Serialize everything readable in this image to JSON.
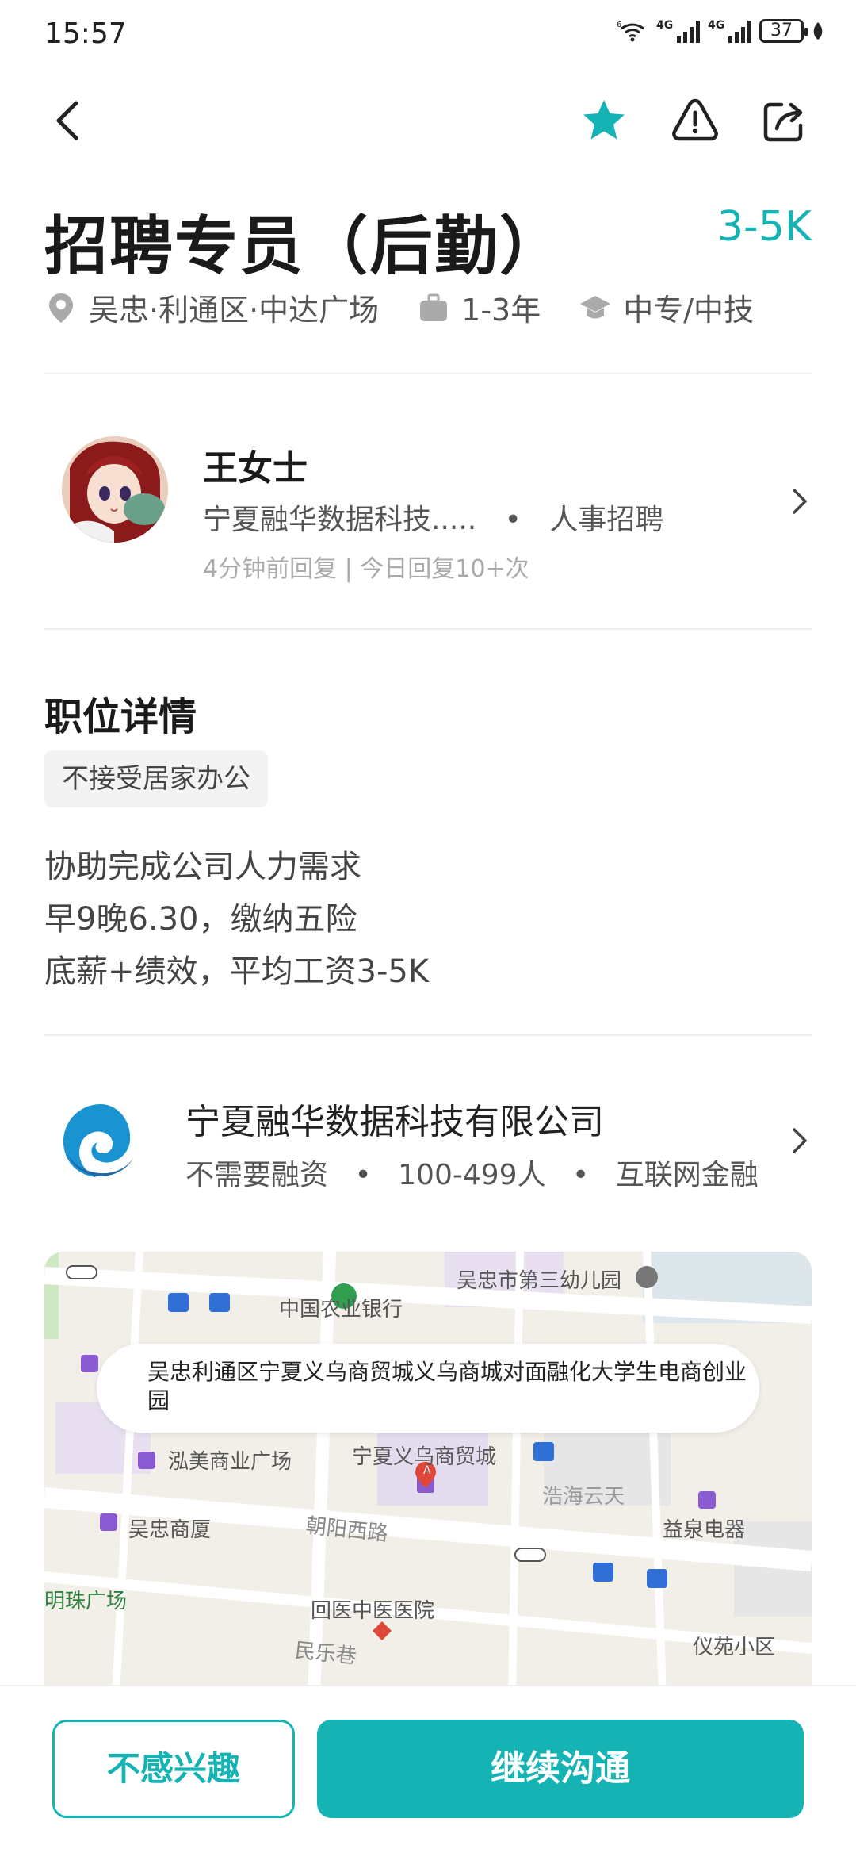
{
  "status_bar": {
    "time": "15:57",
    "battery": "37",
    "signal_label": "4G",
    "wifi_label": "6"
  },
  "nav": {
    "icons": [
      "back-arrow-icon",
      "star-icon",
      "warning-icon",
      "share-icon"
    ],
    "accent_color": "#15b3b3"
  },
  "job": {
    "title": "招聘专员（后勤）",
    "salary": "3-5K",
    "location": "吴忠·利通区·中达广场",
    "experience": "1-3年",
    "education": "中专/中技"
  },
  "recruiter": {
    "name": "王女士",
    "company_short": "宁夏融华数据科技.....",
    "separator": "•",
    "role": "人事招聘",
    "reply_info": "4分钟前回复 | 今日回复10+次"
  },
  "details": {
    "section_title": "职位详情",
    "tag": "不接受居家办公",
    "lines": [
      "协助完成公司人力需求",
      "早9晚6.30，缴纳五险",
      "底薪+绩效，平均工资3-5K"
    ]
  },
  "company": {
    "name": "宁夏融华数据科技有限公司",
    "funding": "不需要融资",
    "size": "100-499人",
    "industry": "互联网金融",
    "separator": "•"
  },
  "map": {
    "address": "吴忠利通区宁夏义乌商贸城义乌商城对面融化大学生电商创业园",
    "labels": {
      "kindergarten": "吴忠市第三幼儿园",
      "bank": "中国农业银行",
      "plaza": "泓美商业广场",
      "trade_city": "宁夏义乌商贸城",
      "haohai": "浩海云天",
      "building": "吴忠商厦",
      "road": "朝阳西路",
      "yiquan": "益泉电器",
      "mingzhu": "明珠广场",
      "hospital": "回医中医医院",
      "lane": "民乐巷",
      "yiyuan": "仪苑小区",
      "marker": "A"
    }
  },
  "actions": {
    "not_interested": "不感兴趣",
    "continue_chat": "继续沟通"
  }
}
